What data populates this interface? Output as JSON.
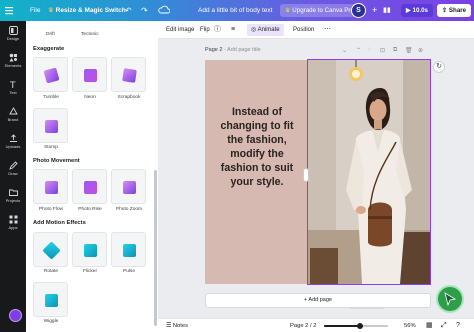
{
  "topbar": {
    "file_label": "File",
    "resize_label": "Resize & Magic Switch",
    "doc_title": "Add a little bit of body text",
    "upgrade_label": "Upgrade to Canva Pro",
    "avatar_initial": "S",
    "timer_label": "10.0s",
    "share_label": "Share"
  },
  "rail": {
    "items": [
      "Design",
      "Elements",
      "Text",
      "Brand",
      "Uploads",
      "Draw",
      "Projects",
      "Apps"
    ]
  },
  "panel": {
    "top_labels": [
      "Drift",
      "Tectonic"
    ],
    "sections": [
      {
        "title": "Exaggerate",
        "items": [
          "Tumble",
          "Neon",
          "Scrapbook",
          "Stomp"
        ]
      },
      {
        "title": "Photo Movement",
        "items": [
          "Photo Flow",
          "Photo Rise",
          "Photo Zoom"
        ]
      },
      {
        "title": "Add Motion Effects",
        "items": [
          "Rotate",
          "Flicker",
          "Pulse",
          "Wiggle"
        ]
      }
    ]
  },
  "toolbar": {
    "edit_image": "Edit image",
    "flip": "Flip",
    "animate": "Animate",
    "position": "Position"
  },
  "page": {
    "label": "Page 2",
    "title_placeholder": "- Add page title",
    "body_text": "Instead of changing to fit the fashion, modify the fashion to suit your style.",
    "add_page": "+ Add page"
  },
  "bottombar": {
    "notes": "Notes",
    "page_indicator": "Page 2 / 2",
    "zoom": "56%",
    "zoom_fraction": 0.56
  },
  "colors": {
    "accent": "#8b3df0",
    "rail_bg": "#18191b",
    "canvas_bg": "#d6b9b1",
    "magic_button": "#5b3bd8",
    "green_fab": "#2e9e4a"
  }
}
